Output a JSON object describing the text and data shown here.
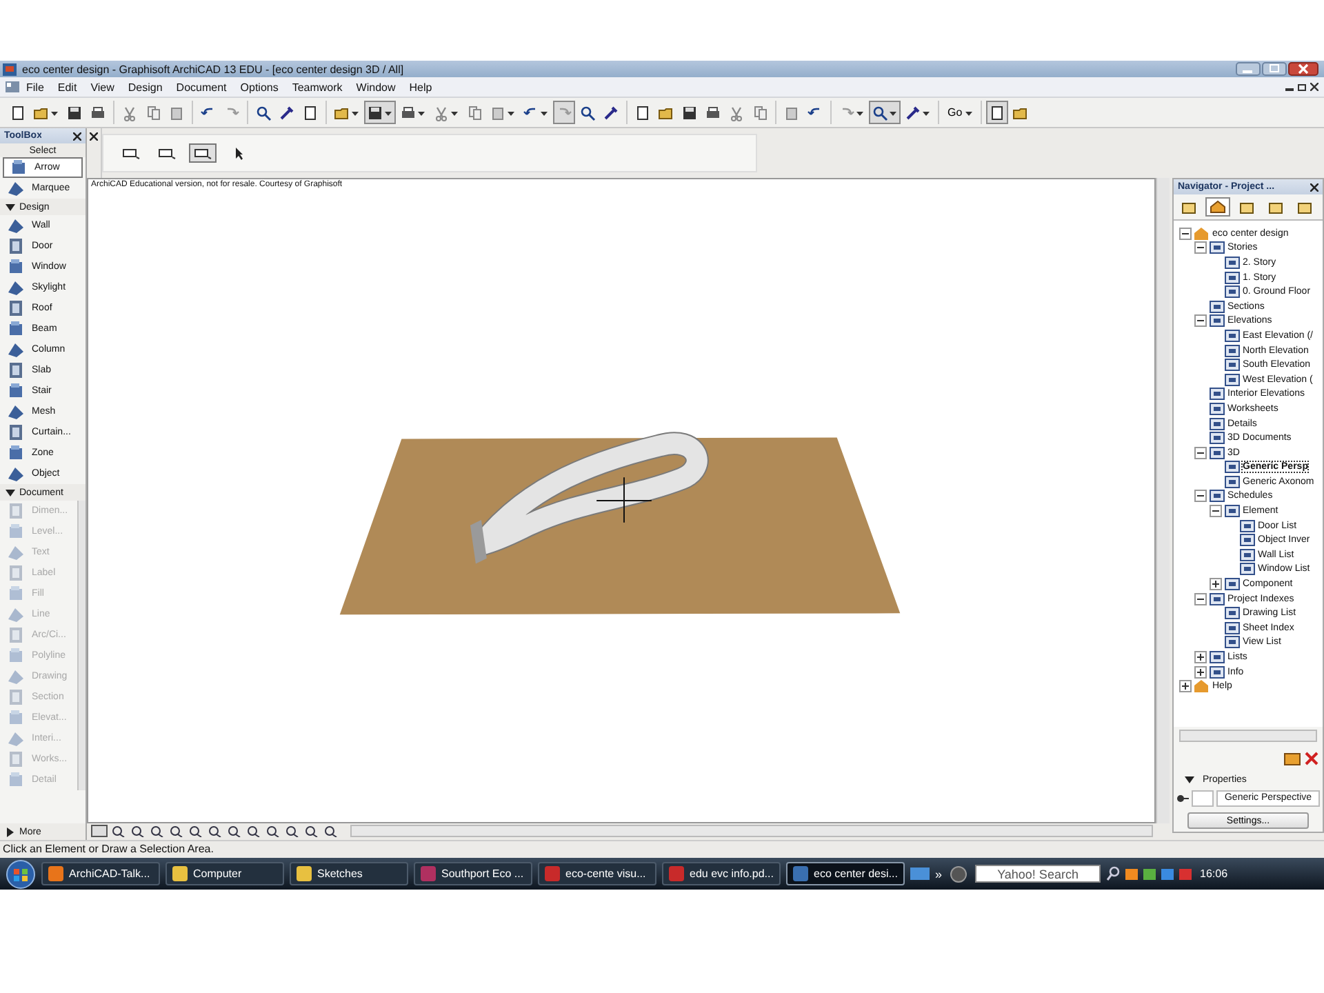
{
  "window": {
    "title": "eco center design - Graphisoft ArchiCAD 13 EDU - [eco center design 3D / All]"
  },
  "menu": [
    "File",
    "Edit",
    "View",
    "Design",
    "Document",
    "Options",
    "Teamwork",
    "Window",
    "Help"
  ],
  "toolbar": {
    "groups": [
      [
        {
          "pressed": false,
          "menu": false
        },
        {
          "pressed": false,
          "menu": true
        },
        {
          "pressed": false,
          "menu": false
        },
        {
          "pressed": false,
          "menu": false
        }
      ],
      [
        {
          "pressed": false,
          "menu": false
        },
        {
          "pressed": false,
          "menu": false
        },
        {
          "pressed": false,
          "menu": false
        }
      ],
      [
        {
          "pressed": false,
          "menu": false
        },
        {
          "pressed": false,
          "menu": false
        }
      ],
      [
        {
          "pressed": false,
          "menu": false
        },
        {
          "pressed": false,
          "menu": false
        },
        {
          "pressed": false,
          "menu": false
        }
      ],
      [
        {
          "pressed": false,
          "menu": true
        },
        {
          "pressed": true,
          "menu": true
        },
        {
          "pressed": false,
          "menu": true
        },
        {
          "pressed": false,
          "menu": true
        },
        {
          "pressed": false,
          "menu": false
        },
        {
          "pressed": false,
          "menu": true
        },
        {
          "pressed": false,
          "menu": true
        },
        {
          "pressed": true,
          "menu": false
        },
        {
          "pressed": false,
          "menu": false
        },
        {
          "pressed": false,
          "menu": false
        }
      ],
      [
        {
          "pressed": false,
          "menu": false
        },
        {
          "pressed": false,
          "menu": false
        },
        {
          "pressed": false,
          "menu": false
        },
        {
          "pressed": false,
          "menu": false
        },
        {
          "pressed": false,
          "menu": false
        },
        {
          "pressed": false,
          "menu": false
        }
      ],
      [
        {
          "pressed": false,
          "menu": false
        },
        {
          "pressed": false,
          "menu": false
        }
      ],
      [
        {
          "pressed": false,
          "menu": true
        },
        {
          "pressed": true,
          "menu": true
        },
        {
          "pressed": false,
          "menu": true
        }
      ],
      [
        {
          "pressed": false,
          "menu": true,
          "label": "Go"
        }
      ],
      [
        {
          "pressed": true,
          "menu": false
        },
        {
          "pressed": false,
          "menu": false
        }
      ]
    ]
  },
  "toolbox": {
    "title": "ToolBox",
    "sections": [
      {
        "title": "Select",
        "items": [
          {
            "label": "Arrow",
            "selected": true,
            "disabled": false
          },
          {
            "label": "Marquee",
            "selected": false,
            "disabled": false
          }
        ]
      },
      {
        "title": "Design",
        "expanded": true,
        "items": [
          {
            "label": "Wall",
            "selected": false,
            "disabled": false
          },
          {
            "label": "Door",
            "selected": false,
            "disabled": false
          },
          {
            "label": "Window",
            "selected": false,
            "disabled": false
          },
          {
            "label": "Skylight",
            "selected": false,
            "disabled": false
          },
          {
            "label": "Roof",
            "selected": false,
            "disabled": false
          },
          {
            "label": "Beam",
            "selected": false,
            "disabled": false
          },
          {
            "label": "Column",
            "selected": false,
            "disabled": false
          },
          {
            "label": "Slab",
            "selected": false,
            "disabled": false
          },
          {
            "label": "Stair",
            "selected": false,
            "disabled": false
          },
          {
            "label": "Mesh",
            "selected": false,
            "disabled": false
          },
          {
            "label": "Curtain...",
            "selected": false,
            "disabled": false
          },
          {
            "label": "Zone",
            "selected": false,
            "disabled": false
          },
          {
            "label": "Object",
            "selected": false,
            "disabled": false
          }
        ]
      },
      {
        "title": "Document",
        "expanded": true,
        "items": [
          {
            "label": "Dimen...",
            "selected": false,
            "disabled": true
          },
          {
            "label": "Level...",
            "selected": false,
            "disabled": true
          },
          {
            "label": "Text",
            "selected": false,
            "disabled": true
          },
          {
            "label": "Label",
            "selected": false,
            "disabled": true
          },
          {
            "label": "Fill",
            "selected": false,
            "disabled": true
          },
          {
            "label": "Line",
            "selected": false,
            "disabled": true
          },
          {
            "label": "Arc/Ci...",
            "selected": false,
            "disabled": true
          },
          {
            "label": "Polyline",
            "selected": false,
            "disabled": true
          },
          {
            "label": "Drawing",
            "selected": false,
            "disabled": true
          },
          {
            "label": "Section",
            "selected": false,
            "disabled": true
          },
          {
            "label": "Elevat...",
            "selected": false,
            "disabled": true
          },
          {
            "label": "Interi...",
            "selected": false,
            "disabled": true
          },
          {
            "label": "Works...",
            "selected": false,
            "disabled": true
          },
          {
            "label": "Detail",
            "selected": false,
            "disabled": true
          }
        ]
      }
    ],
    "more": {
      "label": "More",
      "expanded": false
    }
  },
  "info_box": {
    "buttons": [
      {
        "pressed": false
      },
      {
        "pressed": false
      },
      {
        "pressed": true
      },
      {
        "pressed": false
      }
    ]
  },
  "viewport": {
    "notice": "ArchiCAD Educational version, not for resale. Courtesy of Graphisoft"
  },
  "navigator": {
    "title": "Navigator - Project ...",
    "tabs": [
      {
        "selected": false
      },
      {
        "selected": true
      },
      {
        "selected": false
      },
      {
        "selected": false
      },
      {
        "selected": false
      }
    ],
    "tree": [
      {
        "label": "eco center design",
        "expanded": true,
        "selected": false,
        "children": [
          {
            "label": "Stories",
            "expanded": true,
            "selected": false,
            "children": [
              {
                "label": "2. Story",
                "selected": false
              },
              {
                "label": "1. Story",
                "selected": false
              },
              {
                "label": "0. Ground Floor",
                "selected": false
              }
            ]
          },
          {
            "label": "Sections",
            "selected": false
          },
          {
            "label": "Elevations",
            "expanded": true,
            "selected": false,
            "children": [
              {
                "label": "East Elevation (/",
                "selected": false
              },
              {
                "label": "North Elevation",
                "selected": false
              },
              {
                "label": "South Elevation",
                "selected": false
              },
              {
                "label": "West Elevation (",
                "selected": false
              }
            ]
          },
          {
            "label": "Interior Elevations",
            "selected": false
          },
          {
            "label": "Worksheets",
            "selected": false
          },
          {
            "label": "Details",
            "selected": false
          },
          {
            "label": "3D Documents",
            "selected": false
          },
          {
            "label": "3D",
            "expanded": true,
            "selected": false,
            "children": [
              {
                "label": "Generic Persp",
                "selected": true
              },
              {
                "label": "Generic Axonom",
                "selected": false
              }
            ]
          },
          {
            "label": "Schedules",
            "expanded": true,
            "selected": false,
            "children": [
              {
                "label": "Element",
                "expanded": true,
                "selected": false,
                "children": [
                  {
                    "label": "Door List",
                    "selected": false
                  },
                  {
                    "label": "Object Inver",
                    "selected": false
                  },
                  {
                    "label": "Wall List",
                    "selected": false
                  },
                  {
                    "label": "Window List",
                    "selected": false
                  }
                ]
              },
              {
                "label": "Component",
                "expanded": false,
                "selected": false
              }
            ]
          },
          {
            "label": "Project Indexes",
            "expanded": true,
            "selected": false,
            "children": [
              {
                "label": "Drawing List",
                "selected": false
              },
              {
                "label": "Sheet Index",
                "selected": false
              },
              {
                "label": "View List",
                "selected": false
              }
            ]
          },
          {
            "label": "Lists",
            "expanded": false,
            "selected": false
          },
          {
            "label": "Info",
            "expanded": false,
            "selected": false
          }
        ]
      },
      {
        "label": "Help",
        "expanded": false,
        "selected": false
      }
    ],
    "properties": {
      "title": "Properties",
      "expanded": true,
      "view_name": "Generic Perspective",
      "settings_button": "Settings..."
    }
  },
  "status_bar": "Click an Element or Draw a Selection Area.",
  "taskbar": {
    "items": [
      {
        "label": "ArchiCAD-Talk...",
        "selected": false
      },
      {
        "label": "Computer",
        "selected": false
      },
      {
        "label": "Sketches",
        "selected": false
      },
      {
        "label": "Southport Eco ...",
        "selected": false
      },
      {
        "label": "eco-cente visu...",
        "selected": false
      },
      {
        "label": "edu evc info.pd...",
        "selected": false
      },
      {
        "label": "eco center desi...",
        "selected": true
      }
    ],
    "overflow": "»",
    "search_placeholder": "Yahoo! Search",
    "clock": "16:06"
  }
}
